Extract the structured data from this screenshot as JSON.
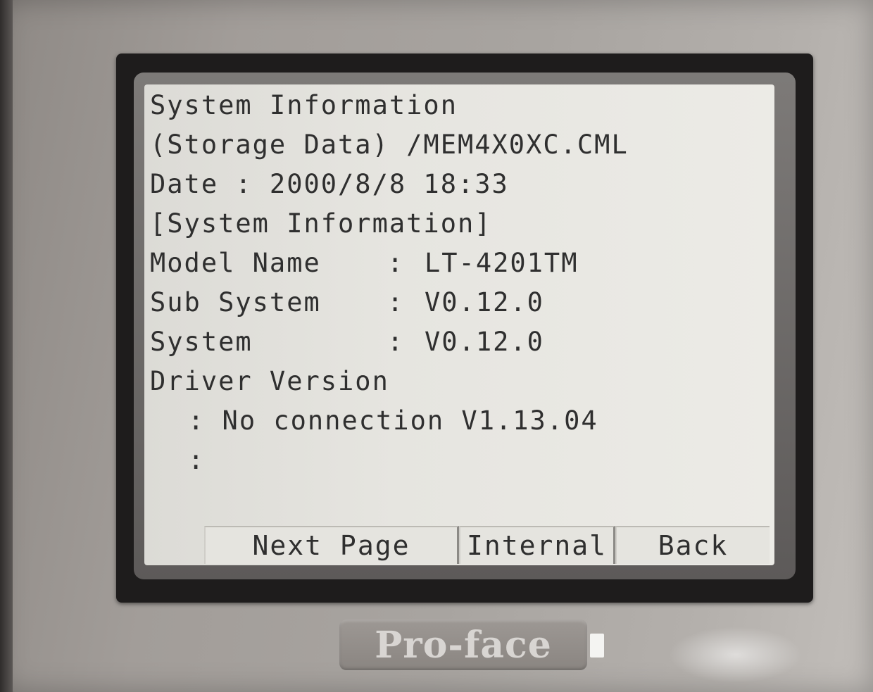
{
  "screen": {
    "title": "System Information",
    "storage_line": "(Storage Data) /MEM4X0XC.CML",
    "date_line": "Date : 2000/8/8 18:33",
    "section_header": "[System Information]",
    "rows": [
      {
        "label": "Model Name",
        "sep": ":",
        "value": "LT-4201TM"
      },
      {
        "label": "Sub System",
        "sep": ":",
        "value": "V0.12.0"
      },
      {
        "label": "System",
        "sep": ":",
        "value": "V0.12.0"
      }
    ],
    "driver_label": "Driver Version",
    "driver_line": ": No connection V1.13.04",
    "driver_line2": ":"
  },
  "buttons": {
    "next_page": "Next Page",
    "internal": "Internal",
    "back": "Back"
  },
  "brand": {
    "logo": "Pro-face"
  }
}
